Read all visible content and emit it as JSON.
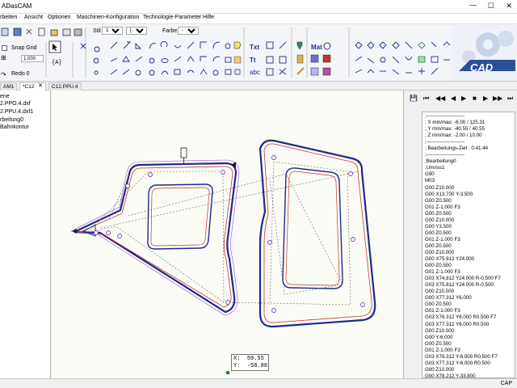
{
  "window": {
    "title": "ADasCAM"
  },
  "menu": [
    "rbeiten",
    "Ansicht",
    "Optionen",
    "Maschinen-Konfiguration",
    "Technologie-Parameter",
    "Hilfe"
  ],
  "ribbon": {
    "stil_label": "Stil",
    "farbe_label": "Farbe",
    "snap_grid_label": "Snap Grid",
    "snap_grid_value": "1.000",
    "redo_label": "Redo 0",
    "txt_label": "Txt",
    "mat_label": "Mat",
    "logo_text": "CAD"
  },
  "tabs": [
    {
      "label": "AM1",
      "active": false
    },
    {
      "label": "*C12",
      "active": true
    },
    {
      "label": "C12.PPU.4",
      "active": false
    }
  ],
  "tree": [
    "ene",
    "2.PPO.4.dxf",
    "2.PPU.4.dxf1",
    "rbeitung0",
    "Bahnkontur"
  ],
  "coords": {
    "x_label": "X:",
    "x_value": "59.55",
    "y_label": "Y:",
    "y_value": "-58.88"
  },
  "nc_program": [
    ";-----------------------",
    "; X min/max:  -6.00 / 125.31",
    "; Y min/max: -40.55 /  40.55",
    "; Z min/max:  -2.00 /  10.00",
    ";-----------------------",
    "; Bearbeitungs-Zeit : 0:41:44",
    ";-----------------------",
    ";Bearbeitung0",
    ";Umriss1",
    "G90",
    "M03",
    "G00 Z10.000",
    "G00 X13.700 Y-3.500",
    "G00 Z0.500",
    "G01 Z-1.000 F3",
    "G00 Z0.500",
    "G00 Z10.000",
    "G00 Y3.500",
    "G00 Z0.500",
    "G01 Z-1.000 F3",
    "G00 Z0.500",
    "G00 Z10.000",
    "G00 X75.812 Y24.000",
    "G00 Z0.500",
    "G01 Z-1.000 F3",
    "G03 X74.812 Y24.000 R-0.500 F7",
    "G03 X75.812 Y24.000 R-0.500",
    "G00 Z10.000",
    "G00 X77.312 Y6.000",
    "G00 Z0.500",
    "G01 Z-1.000 F3",
    "G03 X76.312 Y6.000 R0.500 F7",
    "G03 X77.312 Y6.000 R0.500",
    "G00 Z10.000",
    "G00 Y-6.000",
    "G00 Z0.500",
    "G01 Z-1.000 F3",
    "G03 X76.312 Y-6.000 R0.500 F7",
    "G03 X77.312 Y-6.000 R0.500",
    "G00 Z10.000",
    "G00 X78.212 Y-33.800",
    "G00 Z0.500",
    "G01 Z-1.000 F3",
    "G03 X77.312 Y-33.800 R0.500 F7"
  ],
  "status": {
    "right": "CAP"
  },
  "colors": {
    "accent": "#3a5ea8",
    "contour": "#1f2a8c",
    "toolpath_red": "#c0392b",
    "toolpath_purple": "#9a4fb8"
  }
}
